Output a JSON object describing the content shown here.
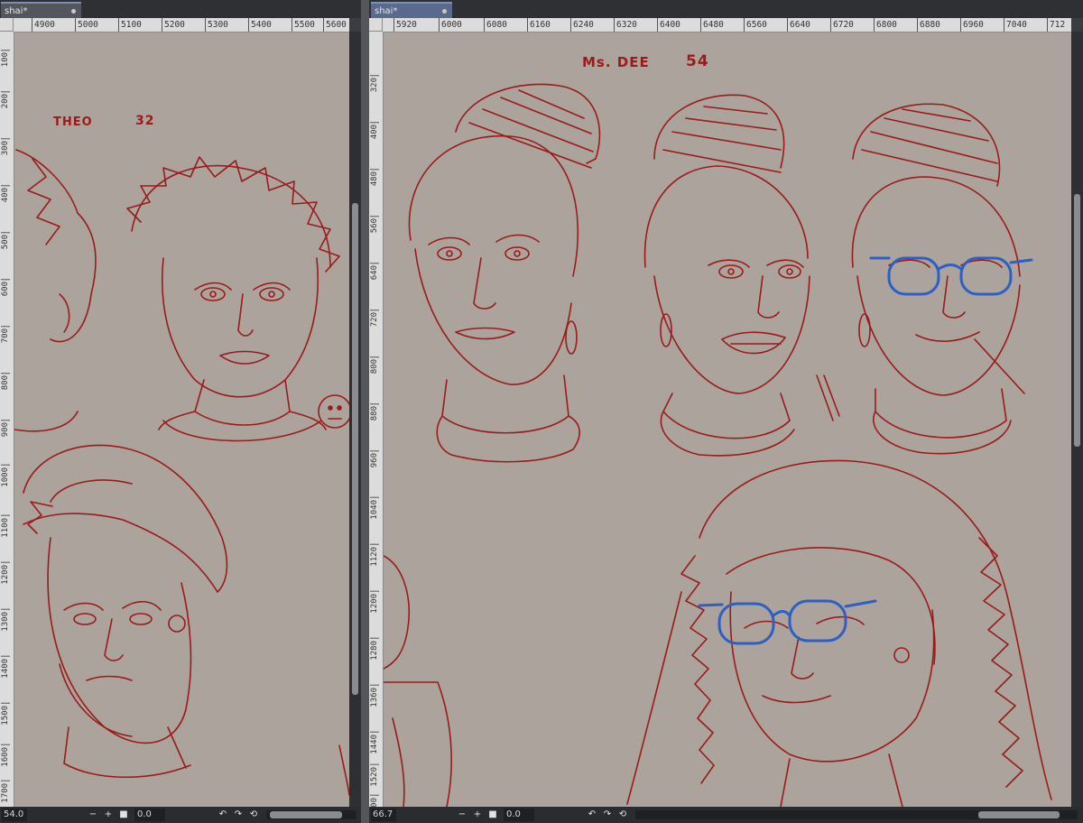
{
  "left_pane": {
    "tab_title": "shai*",
    "ruler_top": [
      "4900",
      "5000",
      "5100",
      "5200",
      "5300",
      "5400",
      "5500",
      "5600"
    ],
    "ruler_left": [
      "100",
      "200",
      "300",
      "400",
      "500",
      "600",
      "700",
      "800",
      "900",
      "1000",
      "1100",
      "1200",
      "1300",
      "1400",
      "1500",
      "1600",
      "1700"
    ],
    "status": {
      "zoom": "54.0",
      "zoom_out": "−",
      "zoom_in": "+",
      "fit": "■",
      "angle": "0.0",
      "rotate_left": "↶",
      "rotate_right": "↷",
      "reset_rotation": "⟲"
    },
    "canvas": {
      "name_label": "THEO",
      "age_label": "32"
    }
  },
  "right_pane": {
    "tab_title": "shai*",
    "ruler_top": [
      "5920",
      "6000",
      "6080",
      "6160",
      "6240",
      "6320",
      "6400",
      "6480",
      "6560",
      "6640",
      "6720",
      "6800",
      "6880",
      "6960",
      "7040",
      "712"
    ],
    "ruler_left": [
      "320",
      "400",
      "480",
      "560",
      "640",
      "720",
      "800",
      "880",
      "960",
      "1040",
      "1120",
      "1200",
      "1280",
      "1360",
      "1440",
      "1520",
      "1600"
    ],
    "status": {
      "zoom": "66.7",
      "zoom_out": "−",
      "zoom_in": "+",
      "fit": "■",
      "angle": "0.0",
      "rotate_left": "↶",
      "rotate_right": "↷",
      "reset_rotation": "⟲"
    },
    "canvas": {
      "name_label": "Ms. DEE",
      "age_label": "54"
    }
  },
  "colors": {
    "canvas": "#aba39c",
    "sketch_red": "#9b1b1b",
    "glasses_blue": "#2d5fc4"
  }
}
